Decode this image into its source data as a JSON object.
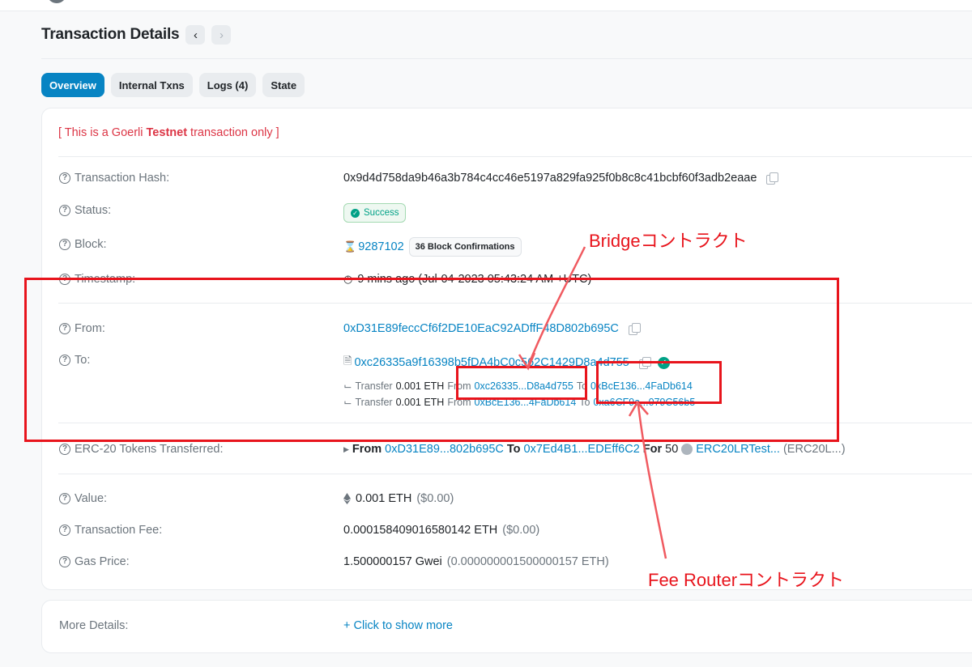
{
  "header": {
    "title": "Transaction Details",
    "prev_icon": "chevron-left-icon",
    "next_icon": "chevron-right-icon"
  },
  "tabs": [
    {
      "label": "Overview",
      "active": true
    },
    {
      "label": "Internal Txns",
      "active": false
    },
    {
      "label": "Logs (4)",
      "active": false
    },
    {
      "label": "State",
      "active": false
    }
  ],
  "testnet_notice": {
    "prefix": "[ This is a Goerli ",
    "bold": "Testnet",
    "suffix": " transaction only ]"
  },
  "details": {
    "tx_hash": {
      "label": "Transaction Hash:",
      "value": "0x9d4d758da9b46a3b784c4cc46e5197a829fa925f0b8c8c41bcbf60f3adb2eaae"
    },
    "status": {
      "label": "Status:",
      "value": "Success"
    },
    "block": {
      "label": "Block:",
      "value": "9287102",
      "confirmations": "36 Block Confirmations"
    },
    "timestamp": {
      "label": "Timestamp:",
      "value": "9 mins ago (Jul-04-2023 05:43:24 AM +UTC)"
    },
    "from": {
      "label": "From:",
      "value": "0xD31E89feccCf6f2DE10EaC92ADffF48D802b695C"
    },
    "to": {
      "label": "To:",
      "value": "0xc26335a9f16398b5fDA4bC0c562C1429D8a4d755"
    },
    "transfers": [
      {
        "prefix": "Transfer",
        "amount": "0.001 ETH",
        "from_word": "From",
        "from": "0xc26335...D8a4d755",
        "to_word": "To",
        "to": "0xBcE136...4FaDb614"
      },
      {
        "prefix": "Transfer",
        "amount": "0.001 ETH",
        "from_word": "From",
        "from": "0xBcE136...4FaDb614",
        "to_word": "To",
        "to": "0xa6CF9a...079C56b5"
      }
    ],
    "erc20": {
      "label": "ERC-20 Tokens Transferred:",
      "from_word": "From",
      "from": "0xD31E89...802b695C",
      "to_word": "To",
      "to": "0x7Ed4B1...EDEff6C2",
      "for_word": "For",
      "amount": "50",
      "token": "ERC20LRTest...",
      "token_symbol": "(ERC20L...)"
    },
    "value": {
      "label": "Value:",
      "amount": "0.001 ETH",
      "usd": "($0.00)"
    },
    "fee": {
      "label": "Transaction Fee:",
      "amount": "0.000158409016580142 ETH",
      "usd": "($0.00)"
    },
    "gas": {
      "label": "Gas Price:",
      "amount": "1.500000157 Gwei",
      "eth": "(0.000000001500000157 ETH)"
    }
  },
  "more": {
    "label": "More Details:",
    "link": "+ Click to show more"
  },
  "annotations": {
    "bridge": "Bridgeコントラクト",
    "fee_router": "Fee Routerコントラクト",
    "color": "#e8141c"
  },
  "colors": {
    "accent": "#0784c3",
    "success": "#00a186",
    "danger": "#dc3545"
  }
}
